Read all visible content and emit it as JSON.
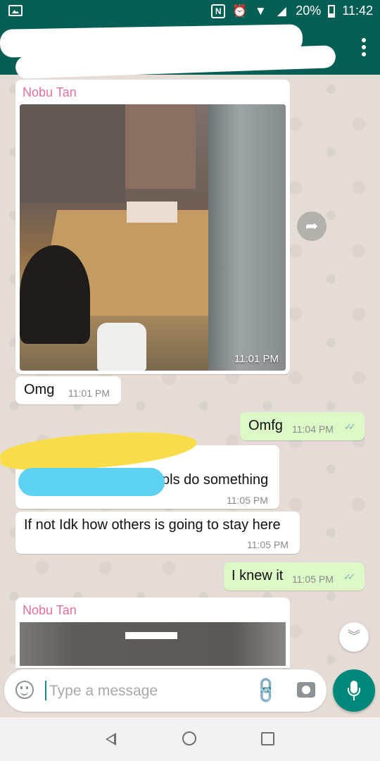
{
  "status_bar": {
    "battery": "20%",
    "time": "11:42"
  },
  "chat": {
    "messages": [
      {
        "sender": "Nobu Tan",
        "type": "image",
        "time": "11:01 PM"
      },
      {
        "direction": "in",
        "text": "Omg",
        "time": "11:01 PM"
      },
      {
        "direction": "out",
        "text": "Omfg",
        "time": "11:04 PM"
      },
      {
        "direction": "in",
        "text": "pls do something",
        "time": "11:05 PM"
      },
      {
        "direction": "in",
        "text": "If not Idk how others is going to stay here",
        "time": "11:05 PM"
      },
      {
        "direction": "out",
        "text": "I knew it",
        "time": "11:05 PM"
      },
      {
        "sender": "Nobu Tan",
        "type": "image"
      }
    ]
  },
  "input": {
    "placeholder": "Type a message"
  },
  "colors": {
    "header": "#075e54",
    "outgoing_bubble": "#dcf8c6",
    "sender_name": "#e36f9e",
    "mic_button": "#00897b"
  },
  "icons": {
    "forward": "forward-icon",
    "scroll_down": "chevron-down-icon",
    "emoji": "emoji-icon",
    "attach": "paperclip-icon",
    "camera": "camera-icon",
    "mic": "mic-icon"
  }
}
